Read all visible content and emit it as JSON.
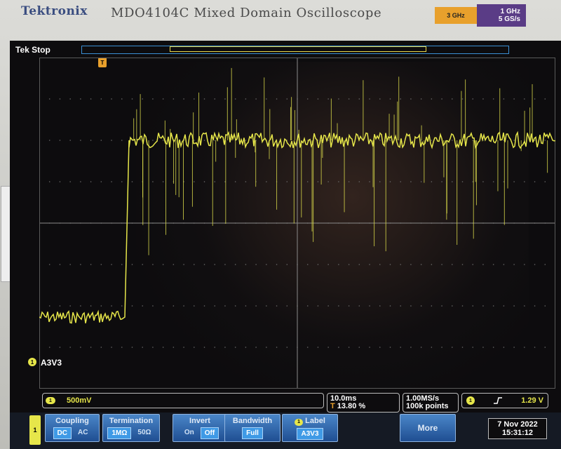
{
  "header": {
    "brand": "Tektronix",
    "model": "MDO4104C Mixed Domain Oscilloscope",
    "badge_left": "3 GHz",
    "badge_right_line1": "1 GHz",
    "badge_right_line2": "5 GS/s"
  },
  "screen": {
    "status": "Tek Stop",
    "trigger_marker": "T",
    "channel_marker": "1",
    "channel_name": "A3V3"
  },
  "readouts": {
    "channel_num": "1",
    "vertical_scale": "500mV",
    "time_per_div": "10.0ms",
    "trigger_pos_icon": "T",
    "trigger_position": "13.80 %",
    "sample_rate": "1.00MS/s",
    "record_length": "100k points",
    "trigger_channel": "1",
    "trigger_slope": "rising-edge-icon",
    "trigger_level": "1.29 V"
  },
  "menu": {
    "channel_tab": "1",
    "coupling": {
      "title": "Coupling",
      "opt1": "DC",
      "opt2": "AC"
    },
    "termination": {
      "title": "Termination",
      "opt1": "1MΩ",
      "opt2": "50Ω"
    },
    "invert": {
      "title": "Invert",
      "opt1": "On",
      "opt2": "Off"
    },
    "bandwidth": {
      "title": "Bandwidth",
      "value": "Full"
    },
    "label": {
      "title": "Label",
      "value": "A3V3",
      "channel": "1"
    },
    "more": "More"
  },
  "datetime": {
    "date": "7 Nov 2022",
    "time": "15:31:12"
  },
  "colors": {
    "trace": "#e6e64a",
    "menu_blue": "#2f6ab0",
    "trigger_orange": "#e8a02c"
  }
}
